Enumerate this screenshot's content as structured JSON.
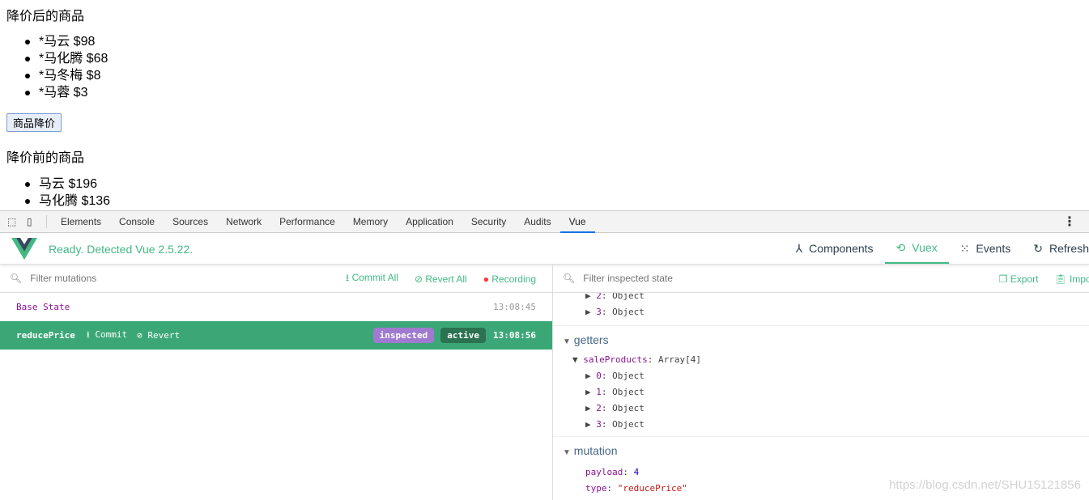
{
  "page": {
    "after_title": "降价后的商品",
    "after_items": [
      "*马云 $98",
      "*马化腾 $68",
      "*马冬梅 $8",
      "*马蓉 $3"
    ],
    "button": "商品降价",
    "before_title": "降价前的商品",
    "before_items": [
      "马云 $196",
      "马化腾 $136"
    ]
  },
  "devtools": {
    "tabs": [
      "Elements",
      "Console",
      "Sources",
      "Network",
      "Performance",
      "Memory",
      "Application",
      "Security",
      "Audits",
      "Vue"
    ],
    "active_tab": "Vue"
  },
  "vue": {
    "status": "Ready. Detected Vue 2.5.22.",
    "nav": [
      "Components",
      "Vuex",
      "Events",
      "Refresh"
    ],
    "active_nav": "Vuex",
    "accent": "#42b983"
  },
  "mutations": {
    "placeholder": "Filter mutations",
    "commit_all": "Commit All",
    "revert_all": "Revert All",
    "recording": "Recording",
    "rows": [
      {
        "name": "Base State",
        "time": "13:08:45"
      },
      {
        "name": "reducePrice",
        "commit": "Commit",
        "revert": "Revert",
        "badge_inspected": "inspected",
        "badge_active": "active",
        "time": "13:08:56"
      }
    ]
  },
  "state": {
    "placeholder": "Filter inspected state",
    "export": "Export",
    "import": "Import",
    "top_items": [
      {
        "k": "2",
        "v": "Object"
      },
      {
        "k": "3",
        "v": "Object"
      }
    ],
    "getters_title": "getters",
    "getter_key": "saleProducts",
    "getter_val": "Array[4]",
    "getter_items": [
      {
        "k": "0",
        "v": "Object"
      },
      {
        "k": "1",
        "v": "Object"
      },
      {
        "k": "2",
        "v": "Object"
      },
      {
        "k": "3",
        "v": "Object"
      }
    ],
    "mutation_title": "mutation",
    "payload_key": "payload",
    "payload_val": "4",
    "type_key": "type",
    "type_val": "\"reducePrice\""
  },
  "watermark": "https://blog.csdn.net/SHU15121856"
}
